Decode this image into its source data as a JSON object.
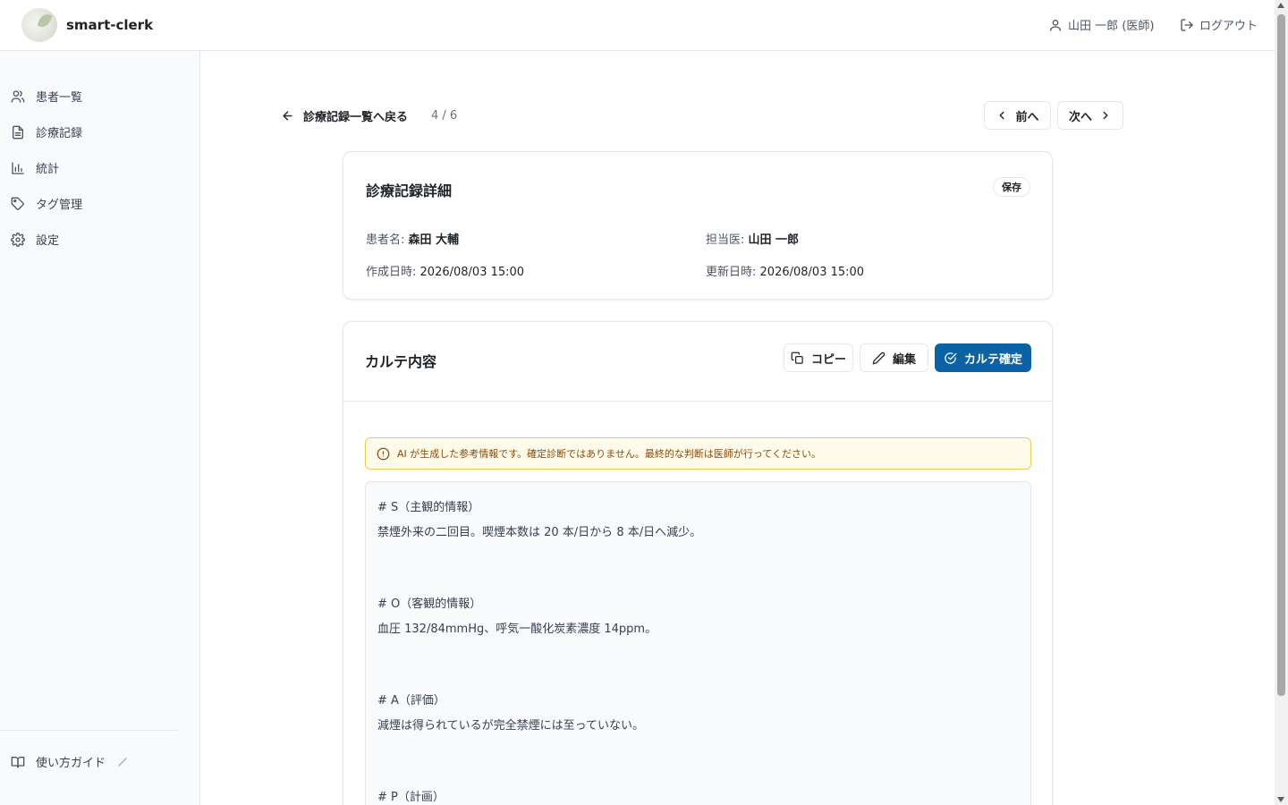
{
  "header": {
    "app_name": "smart-clerk",
    "user_label": "山田 一郎 (医師)",
    "logout_label": "ログアウト"
  },
  "sidebar": {
    "items": [
      {
        "label": "患者一覧",
        "icon": "users-icon"
      },
      {
        "label": "診療記録",
        "icon": "document-icon"
      },
      {
        "label": "統計",
        "icon": "bar-chart-icon"
      },
      {
        "label": "タグ管理",
        "icon": "tag-icon"
      },
      {
        "label": "設定",
        "icon": "gear-icon"
      }
    ],
    "guide_label": "使い方ガイド"
  },
  "toolbar": {
    "back_label": "診療記録一覧へ戻る",
    "page_count": "4 / 6",
    "prev_label": "前へ",
    "next_label": "次へ"
  },
  "detail": {
    "title": "診療記録詳細",
    "status": "保存",
    "patient_label": "患者名:",
    "patient_name": "森田 大輔",
    "doctor_label": "担当医:",
    "doctor_name": "山田 一郎",
    "created_label": "作成日時:",
    "created_at": "2026/08/03 15:00",
    "updated_label": "更新日時:",
    "updated_at": "2026/08/03 15:00"
  },
  "karte": {
    "title": "カルテ内容",
    "copy_label": "コピー",
    "edit_label": "編集",
    "confirm_label": "カルテ確定",
    "warning": "AI が生成した参考情報です。確定診断ではありません。最終的な判断は医師が行ってください。",
    "lines": [
      "# S（主観的情報）",
      "禁煙外来の二回目。喫煙本数は 20 本/日から 8 本/日へ減少。",
      "# O（客観的情報）",
      "血圧 132/84mmHg、呼気一酸化炭素濃度 14ppm。",
      "# A（評価）",
      "減煙は得られているが完全禁煙には至っていない。",
      "# P（計画）"
    ]
  },
  "colors": {
    "accent": "#0b63a5",
    "warning_bg": "#fffbea",
    "warning_border": "#f2c94c",
    "warning_text": "#8a4b08"
  }
}
